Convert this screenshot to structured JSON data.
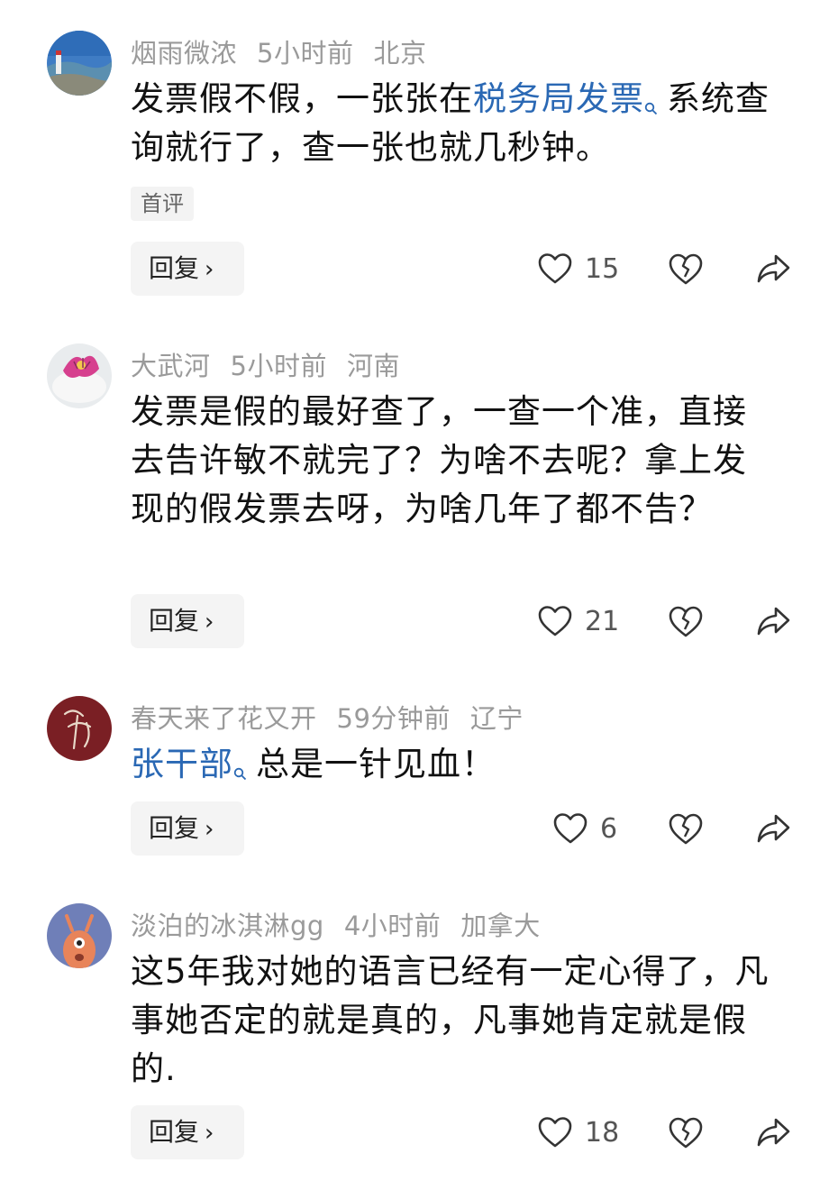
{
  "comments": [
    {
      "user": "烟雨微浓",
      "time": "5小时前",
      "location": "北京",
      "text_before": "发票假不假，一张张在",
      "link": "税务局发票",
      "text_after": "系统查询就行了，查一张也就几秒钟。",
      "tag": "首评",
      "reply_label": "回复",
      "likes": "15"
    },
    {
      "user": "大武河",
      "time": "5小时前",
      "location": "河南",
      "text": "发票是假的最好查了，一查一个准，直接去告许敏不就完了？为啥不去呢？拿上发现的假发票去呀，为啥几年了都不告？",
      "reply_label": "回复",
      "likes": "21"
    },
    {
      "user": "春天来了花又开",
      "time": "59分钟前",
      "location": "辽宁",
      "link": "张干部",
      "text_after": "总是一针见血！",
      "reply_label": "回复",
      "likes": "6"
    },
    {
      "user": "淡泊的冰淇淋gg",
      "time": "4小时前",
      "location": "加拿大",
      "text": "这5年我对她的语言已经有一定心得了，凡事她否定的就是真的，凡事她肯定就是假的.",
      "reply_label": "回复",
      "likes": "18"
    }
  ],
  "colors": {
    "link": "#2a68b4",
    "meta": "#9a9a9a",
    "button_bg": "#f4f4f4"
  }
}
